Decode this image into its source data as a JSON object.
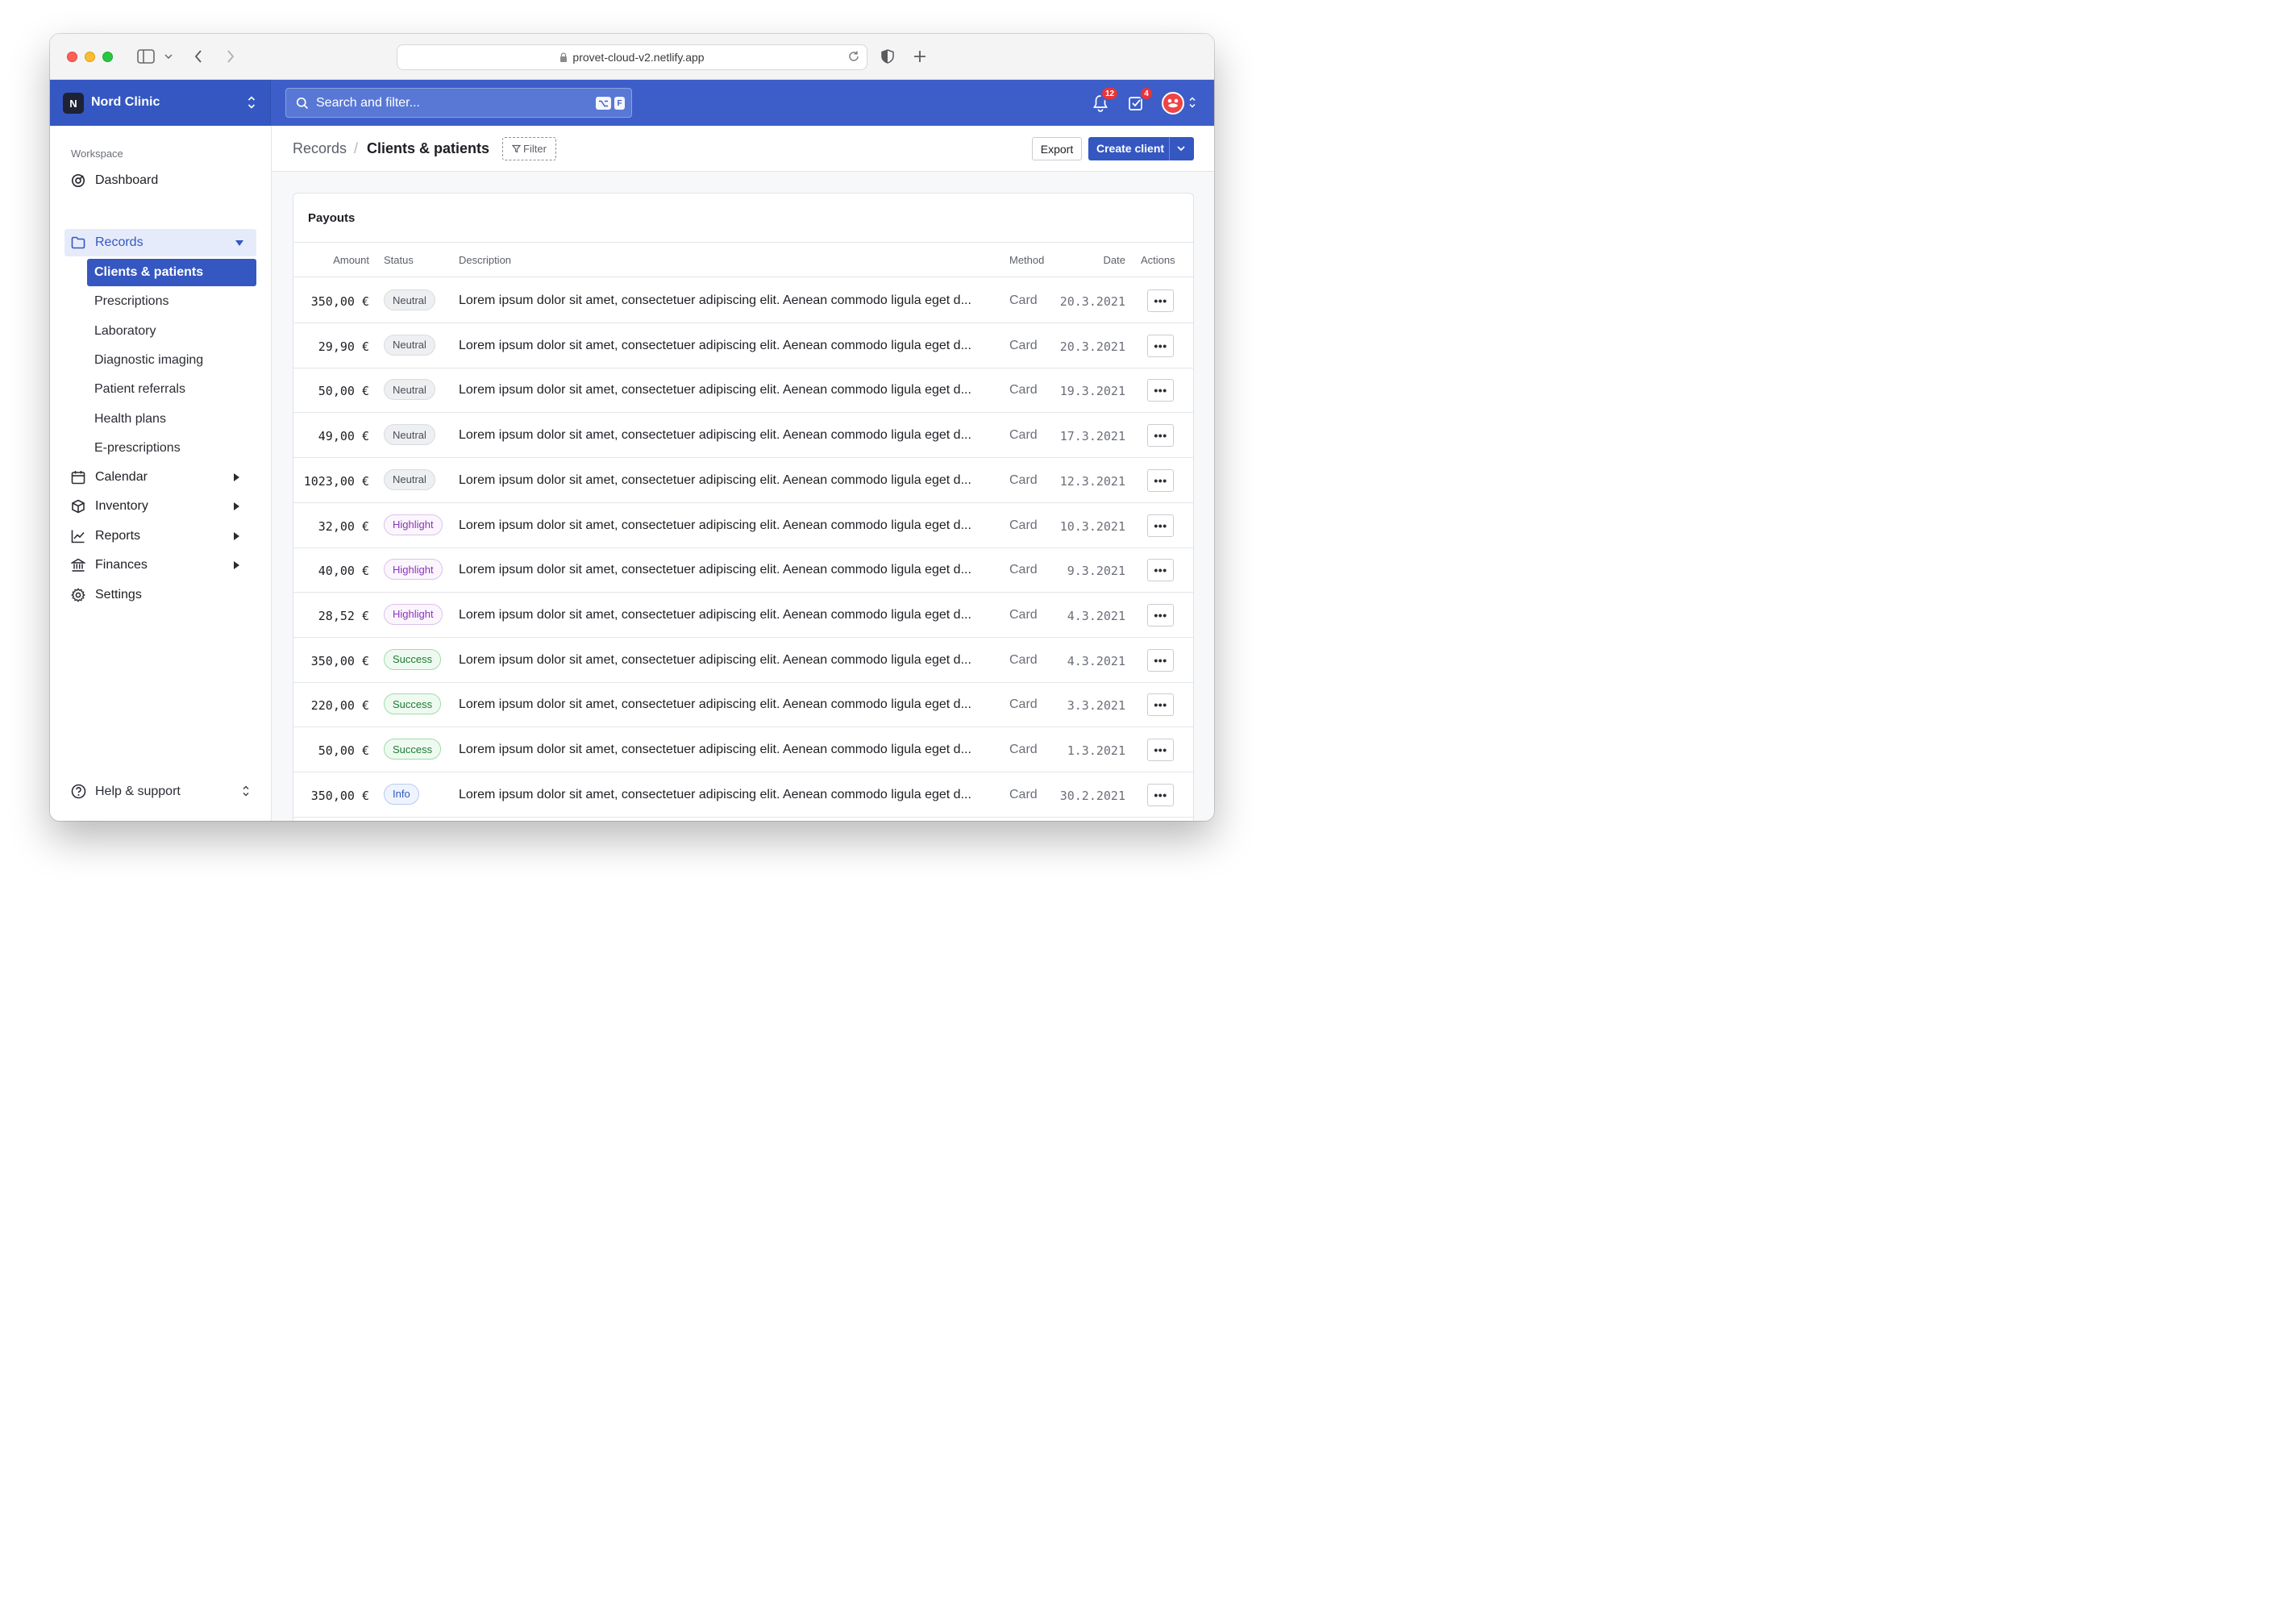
{
  "browser": {
    "url": "provet-cloud-v2.netlify.app"
  },
  "app": {
    "clinic_initial": "N",
    "clinic_name": "Nord Clinic",
    "search_placeholder": "Search and filter...",
    "search_shortcut_key": "F",
    "notifications_count": "12",
    "tasks_count": "4"
  },
  "sidebar": {
    "section_label": "Workspace",
    "items": [
      {
        "label": "Dashboard",
        "icon": "dashboard-icon"
      },
      {
        "label": "Records",
        "icon": "folder-icon"
      },
      {
        "label": "Calendar",
        "icon": "calendar-icon"
      },
      {
        "label": "Inventory",
        "icon": "box-icon"
      },
      {
        "label": "Reports",
        "icon": "chart-icon"
      },
      {
        "label": "Finances",
        "icon": "bank-icon"
      },
      {
        "label": "Settings",
        "icon": "gear-icon"
      }
    ],
    "sub_items": [
      {
        "label": "Clients & patients"
      },
      {
        "label": "Prescriptions"
      },
      {
        "label": "Laboratory"
      },
      {
        "label": "Diagnostic imaging"
      },
      {
        "label": "Patient referrals"
      },
      {
        "label": "Health plans"
      },
      {
        "label": "E-prescriptions"
      }
    ],
    "help_label": "Help & support"
  },
  "page": {
    "breadcrumb_parent": "Records",
    "breadcrumb_separator": "/",
    "breadcrumb_current": "Clients & patients",
    "filter_label": "Filter",
    "export_label": "Export",
    "create_label": "Create client"
  },
  "table": {
    "title": "Payouts",
    "columns": [
      "Amount",
      "Status",
      "Description",
      "Method",
      "Date",
      "Actions"
    ],
    "action_label": "•••",
    "rows": [
      {
        "amount": "350,00 €",
        "status": "Neutral",
        "description": "Lorem ipsum dolor sit amet, consectetuer adipiscing elit. Aenean commodo ligula eget d...",
        "method": "Card",
        "date": "20.3.2021"
      },
      {
        "amount": "29,90 €",
        "status": "Neutral",
        "description": "Lorem ipsum dolor sit amet, consectetuer adipiscing elit. Aenean commodo ligula eget d...",
        "method": "Card",
        "date": "20.3.2021"
      },
      {
        "amount": "50,00 €",
        "status": "Neutral",
        "description": "Lorem ipsum dolor sit amet, consectetuer adipiscing elit. Aenean commodo ligula eget d...",
        "method": "Card",
        "date": "19.3.2021"
      },
      {
        "amount": "49,00 €",
        "status": "Neutral",
        "description": "Lorem ipsum dolor sit amet, consectetuer adipiscing elit. Aenean commodo ligula eget d...",
        "method": "Card",
        "date": "17.3.2021"
      },
      {
        "amount": "1023,00 €",
        "status": "Neutral",
        "description": "Lorem ipsum dolor sit amet, consectetuer adipiscing elit. Aenean commodo ligula eget d...",
        "method": "Card",
        "date": "12.3.2021"
      },
      {
        "amount": "32,00 €",
        "status": "Highlight",
        "description": "Lorem ipsum dolor sit amet, consectetuer adipiscing elit. Aenean commodo ligula eget d...",
        "method": "Card",
        "date": "10.3.2021"
      },
      {
        "amount": "40,00 €",
        "status": "Highlight",
        "description": "Lorem ipsum dolor sit amet, consectetuer adipiscing elit. Aenean commodo ligula eget d...",
        "method": "Card",
        "date": "9.3.2021"
      },
      {
        "amount": "28,52 €",
        "status": "Highlight",
        "description": "Lorem ipsum dolor sit amet, consectetuer adipiscing elit. Aenean commodo ligula eget d...",
        "method": "Card",
        "date": "4.3.2021"
      },
      {
        "amount": "350,00 €",
        "status": "Success",
        "description": "Lorem ipsum dolor sit amet, consectetuer adipiscing elit. Aenean commodo ligula eget d...",
        "method": "Card",
        "date": "4.3.2021"
      },
      {
        "amount": "220,00 €",
        "status": "Success",
        "description": "Lorem ipsum dolor sit amet, consectetuer adipiscing elit. Aenean commodo ligula eget d...",
        "method": "Card",
        "date": "3.3.2021"
      },
      {
        "amount": "50,00 €",
        "status": "Success",
        "description": "Lorem ipsum dolor sit amet, consectetuer adipiscing elit. Aenean commodo ligula eget d...",
        "method": "Card",
        "date": "1.3.2021"
      },
      {
        "amount": "350,00 €",
        "status": "Info",
        "description": "Lorem ipsum dolor sit amet, consectetuer adipiscing elit. Aenean commodo ligula eget d...",
        "method": "Card",
        "date": "30.2.2021"
      }
    ]
  },
  "colors": {
    "brand": "#3d5ec9",
    "brand_dark": "#3457c1",
    "badge": "#e5353a"
  }
}
